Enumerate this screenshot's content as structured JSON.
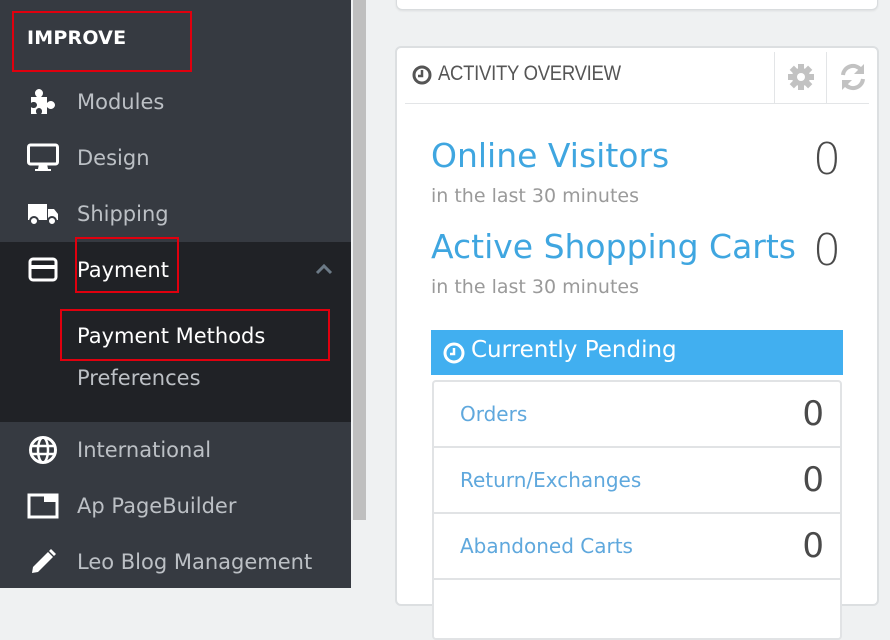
{
  "sidebar": {
    "section_title": "IMPROVE",
    "items": [
      {
        "label": "Modules",
        "icon": "puzzle-icon"
      },
      {
        "label": "Design",
        "icon": "monitor-icon"
      },
      {
        "label": "Shipping",
        "icon": "truck-icon"
      },
      {
        "label": "Payment",
        "icon": "credit-card-icon",
        "expanded": true
      },
      {
        "label": "International",
        "icon": "globe-icon"
      },
      {
        "label": "Ap PageBuilder",
        "icon": "window-icon"
      },
      {
        "label": "Leo Blog Management",
        "icon": "pencil-icon"
      }
    ],
    "payment_subitems": [
      {
        "label": "Payment Methods",
        "active": true
      },
      {
        "label": "Preferences",
        "active": false
      }
    ]
  },
  "activity": {
    "title": "ACTIVITY OVERVIEW",
    "title_icon": "clock-icon",
    "config_icon": "gear-icon",
    "refresh_icon": "refresh-icon",
    "metrics": [
      {
        "label": "Online Visitors",
        "sub": "in the last 30 minutes",
        "value": "0"
      },
      {
        "label": "Active Shopping Carts",
        "sub": "in the last 30 minutes",
        "value": "0"
      }
    ],
    "pending": {
      "title": "Currently Pending",
      "icon": "clock-icon",
      "rows": [
        {
          "label": "Orders",
          "value": "0"
        },
        {
          "label": "Return/Exchanges",
          "value": "0"
        },
        {
          "label": "Abandoned Carts",
          "value": "0"
        }
      ]
    }
  },
  "colors": {
    "sidebar_bg": "#363a41",
    "sidebar_active_bg": "#202226",
    "accent_blue": "#41aff0",
    "link_blue": "#3fa6e0",
    "highlight_red": "#e0000e"
  }
}
